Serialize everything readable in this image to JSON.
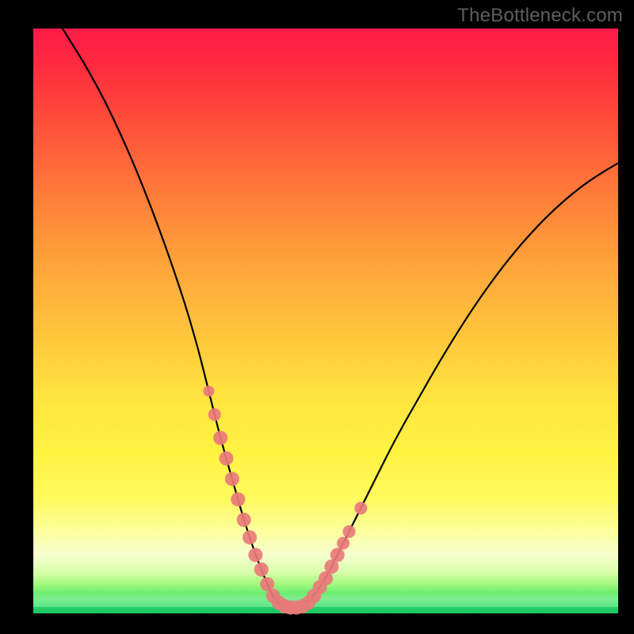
{
  "watermark": "TheBottleneck.com",
  "colors": {
    "curve": "#000000",
    "markers": "#e97a7a",
    "background_frame": "#000000"
  },
  "chart_data": {
    "type": "line",
    "title": "",
    "xlabel": "",
    "ylabel": "",
    "xlim": [
      0,
      100
    ],
    "ylim": [
      0,
      100
    ],
    "grid": false,
    "legend": false,
    "annotations": [],
    "series": [
      {
        "name": "bottleneck-curve",
        "x": [
          5,
          10,
          15,
          20,
          25,
          28,
          30,
          32,
          34,
          36,
          38,
          40,
          41,
          42,
          43,
          44,
          45,
          46,
          48,
          50,
          52,
          55,
          58,
          62,
          66,
          70,
          75,
          80,
          85,
          90,
          95,
          100
        ],
        "y": [
          100,
          92,
          82,
          70,
          56,
          46,
          38,
          30,
          23,
          16,
          10,
          5,
          3,
          1.5,
          1,
          1,
          1,
          1.5,
          3,
          6,
          10,
          16,
          22,
          30,
          37,
          44,
          52,
          59,
          65,
          70,
          74,
          77
        ]
      }
    ],
    "markers": {
      "name": "highlight-points",
      "x": [
        30,
        31,
        32,
        33,
        34,
        35,
        36,
        37,
        38,
        39,
        40,
        41,
        42,
        43,
        44,
        45,
        46,
        47,
        48,
        49,
        50,
        51,
        52,
        53,
        54,
        56
      ],
      "y": [
        38,
        34,
        30,
        26.5,
        23,
        19.5,
        16,
        13,
        10,
        7.5,
        5,
        3,
        1.8,
        1.2,
        1,
        1,
        1.2,
        1.8,
        3,
        4.5,
        6,
        8,
        10,
        12,
        14,
        18
      ],
      "r": [
        7,
        8,
        9,
        9,
        9,
        9,
        9,
        9,
        9,
        9,
        9,
        9,
        9,
        9,
        9,
        9,
        9,
        9,
        9,
        9,
        9,
        9,
        9,
        8,
        8,
        8
      ]
    }
  }
}
